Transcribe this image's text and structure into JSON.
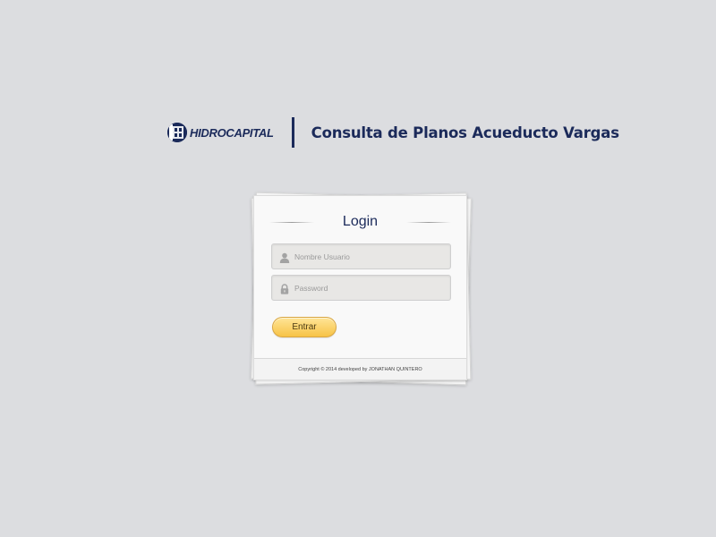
{
  "header": {
    "logo_text": "HIDROCAPITAL",
    "app_title": "Consulta de Planos Acueducto Vargas"
  },
  "login": {
    "title": "Login",
    "username_placeholder": "Nombre Usuario",
    "username_value": "",
    "password_placeholder": "Password",
    "password_value": "",
    "submit_label": "Entrar",
    "footer": "Copyright © 2014 developed by JONATHAN QUINTERO"
  },
  "icons": {
    "user": "user-icon",
    "password": "lock-icon"
  },
  "colors": {
    "background": "#dcdde0",
    "brand_navy": "#1b2a5a",
    "button_gold": "#f7c347"
  }
}
